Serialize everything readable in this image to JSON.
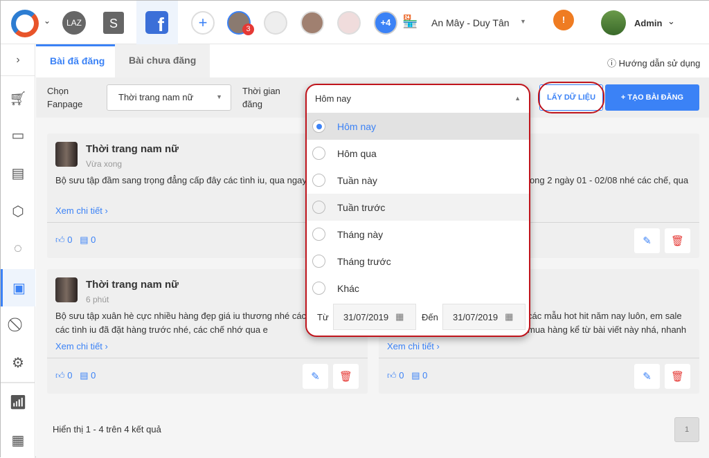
{
  "header": {
    "store_name": "An Mây - Duy Tân",
    "admin": "Admin",
    "lazada": "LAZ",
    "shopee": "S",
    "facebook": "f",
    "more_pages": "+4",
    "badge": "3",
    "warning": "!"
  },
  "tabs": [
    {
      "label": "Bài đã đăng"
    },
    {
      "label": "Bài chưa đăng"
    }
  ],
  "help": "Hướng dẫn sử dụng",
  "filter": {
    "fanpage_label": "Chọn Fanpage",
    "fanpage_value": "Thời trang nam nữ",
    "time_label": "Thời gian đăng",
    "time_value": "Hôm nay",
    "fetch_button": "LẤY DỮ LIỆU",
    "create_button": "+ TẠO BÀI ĐĂNG"
  },
  "dropdown": {
    "options": [
      "Hôm nay",
      "Hôm qua",
      "Tuần này",
      "Tuần trước",
      "Tháng này",
      "Tháng trước",
      "Khác"
    ],
    "from_label": "Từ",
    "from_value": "31/07/2019",
    "to_label": "Đến",
    "to_value": "31/07/2019"
  },
  "posts": [
    {
      "name": "Thời trang nam nữ",
      "time": "Vừa xong",
      "text": "Bộ sưu tập đầm sang trọng đẳng cấp đây các tình iu, qua ngay hàng nhé",
      "more": "Xem chi tiết ›",
      "likes": "0",
      "comments": "0"
    },
    {
      "text": "trong 2 ngày 01 - 02/08 nhé các chế, qua",
      "likes": "0",
      "comments": "0"
    },
    {
      "name": "Thời trang nam nữ",
      "time": "6 phút",
      "text": "Bộ sưu tập xuân hè cực nhiều hàng đẹp giá iu thương nhé các hàng cho các tình iu đã đặt hàng trước nhé, các chế nhớ qua e",
      "more": "Xem chi tiết ›",
      "likes": "0",
      "comments": "0"
    },
    {
      "text": "các mẫu hot hit năm nay luôn, em sale mua hàng kể từ bài viết này nhá, nhanh",
      "more": "Xem chi tiết ›",
      "likes": "0",
      "comments": "0"
    }
  ],
  "footer": {
    "summary": "Hiển thị 1 - 4 trên 4 kết quả",
    "page": "1"
  },
  "colors": {
    "accent": "#3b82f6",
    "danger": "#e53935",
    "highlight": "#c0141c"
  }
}
